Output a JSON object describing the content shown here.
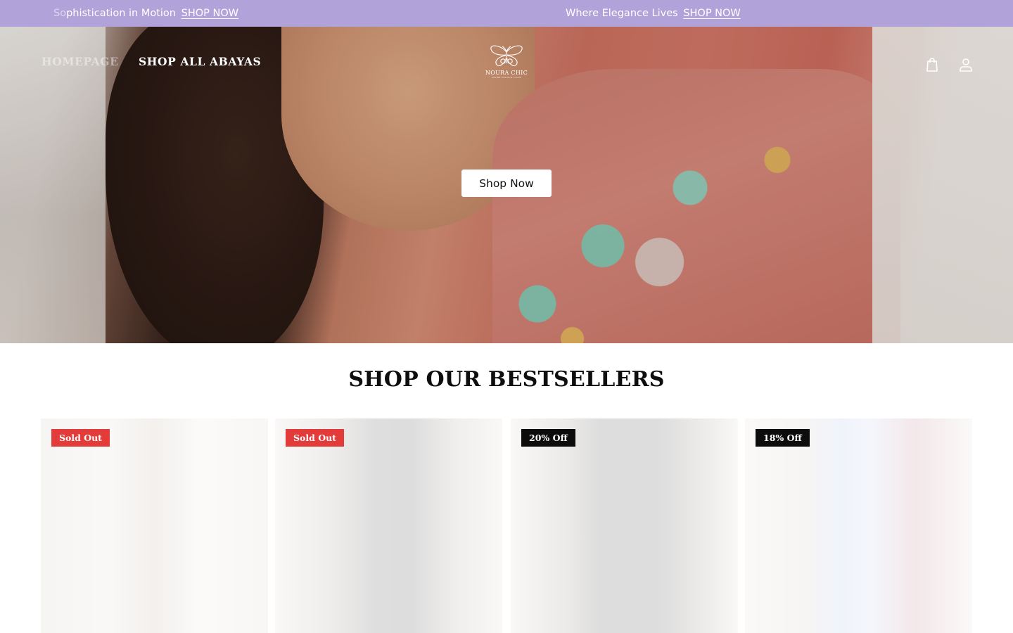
{
  "announcement": {
    "items": [
      {
        "text_faded": "So",
        "text": "phistication in Motion",
        "link": "SHOP NOW"
      },
      {
        "text": "Where Elegance Lives",
        "link": "SHOP NOW"
      }
    ]
  },
  "header": {
    "nav": [
      "HOMEPAGE",
      "SHOP ALL ABAYAS"
    ],
    "logo": {
      "brand": "NOURA CHIC",
      "tagline": "ONLINE FASHION STORE",
      "icon": "butterfly-logo-icon"
    },
    "icons": [
      "cart-icon",
      "account-icon"
    ]
  },
  "hero": {
    "button_label": "Shop Now"
  },
  "bestsellers": {
    "title": "SHOP OUR BESTSELLERS",
    "products": [
      {
        "badge": "Sold Out",
        "badge_type": "sold"
      },
      {
        "badge": "Sold Out",
        "badge_type": "sold"
      },
      {
        "badge": "20% Off",
        "badge_type": "off"
      },
      {
        "badge": "18% Off",
        "badge_type": "off"
      }
    ]
  },
  "colors": {
    "announcement_bg": "#b1a2da",
    "sold_badge": "#e33a3a",
    "discount_badge": "#0c0c0c"
  }
}
